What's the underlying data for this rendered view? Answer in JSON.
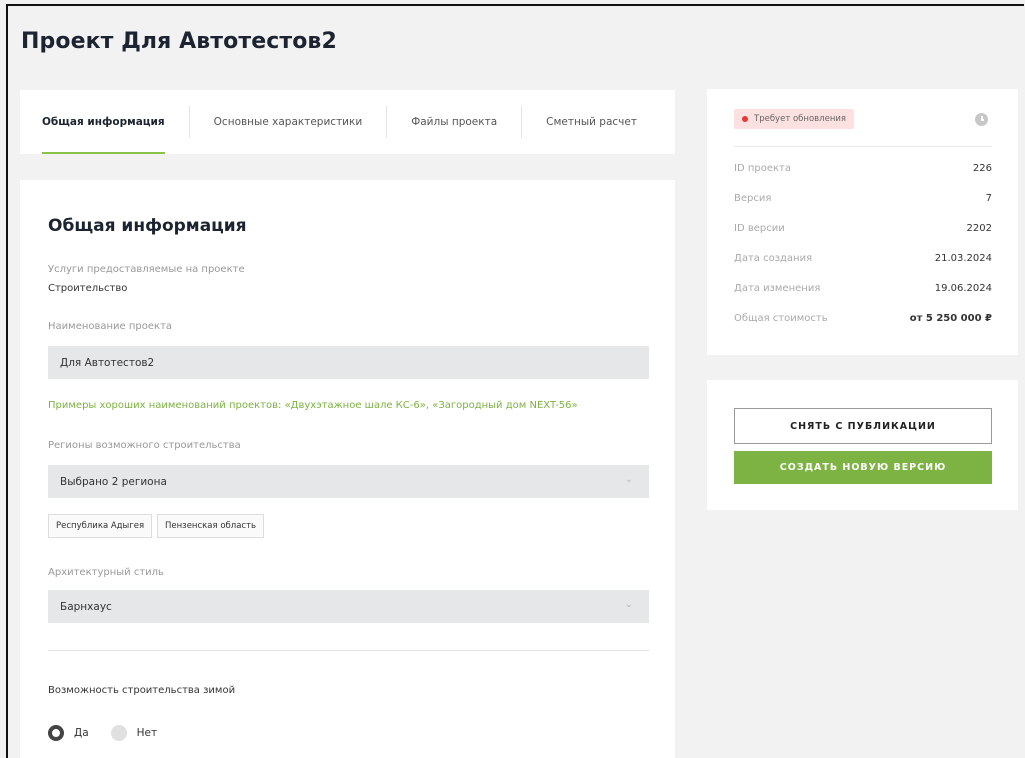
{
  "page": {
    "title": "Проект Для Автотестов2"
  },
  "tabs": [
    {
      "label": "Общая информация",
      "active": true
    },
    {
      "label": "Основные характеристики",
      "active": false
    },
    {
      "label": "Файлы проекта",
      "active": false
    },
    {
      "label": "Сметный расчет",
      "active": false
    }
  ],
  "form": {
    "section_title": "Общая информация",
    "services_label": "Услуги предоставляемые на проекте",
    "services_value": "Строительство",
    "name_label": "Наименование проекта",
    "name_value": "Для Автотестов2",
    "name_hint": "Примеры хороших наименований проектов: «Двухэтажное шале КС-6», «Загородный дом NEXT-56»",
    "regions_label": "Регионы возможного строительства",
    "regions_value": "Выбрано 2 региона",
    "region_chips": [
      "Республика Адыгея",
      "Пензенская область"
    ],
    "style_label": "Архитектурный стиль",
    "style_value": "Барнхаус",
    "winter_label": "Возможность строительства зимой",
    "winter_options": [
      {
        "label": "Да",
        "selected": true
      },
      {
        "label": "Нет",
        "selected": false
      }
    ]
  },
  "info": {
    "status_badge": "Требует обновления",
    "rows": [
      {
        "key": "ID проекта",
        "value": "226"
      },
      {
        "key": "Версия",
        "value": "7"
      },
      {
        "key": "ID версии",
        "value": "2202"
      },
      {
        "key": "Дата создания",
        "value": "21.03.2024"
      },
      {
        "key": "Дата изменения",
        "value": "19.06.2024"
      },
      {
        "key": "Общая стоимость",
        "value": "от 5 250 000 ₽"
      }
    ]
  },
  "actions": {
    "unpublish_label": "СНЯТЬ С ПУБЛИКАЦИИ",
    "new_version_label": "СОЗДАТЬ НОВУЮ ВЕРСИЮ"
  },
  "colors": {
    "accent_green": "#7cb342",
    "status_red": "#e53935",
    "badge_bg": "#fde0e0"
  }
}
